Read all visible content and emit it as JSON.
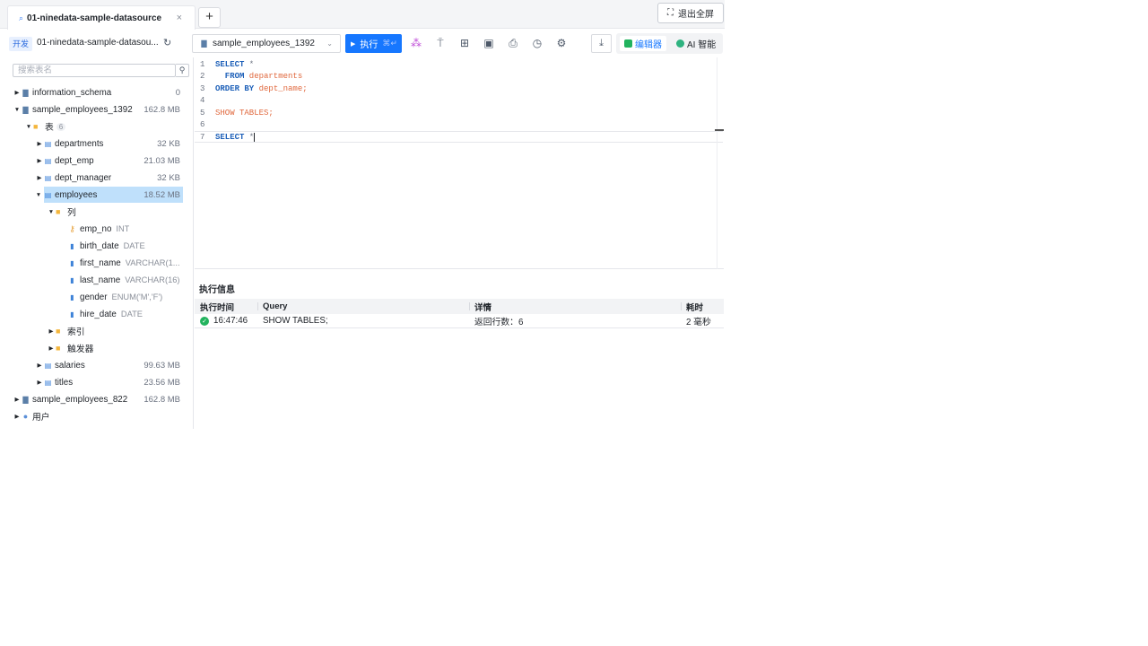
{
  "tabs": {
    "active_title": "01-ninedata-sample-datasource",
    "add_label": "+",
    "exit_fullscreen_label": "退出全屏"
  },
  "toolbar": {
    "env_label": "开发",
    "datasource": "01-ninedata-sample-datasou...",
    "database_selected": "sample_employees_1392",
    "run_label": "执行",
    "run_shortcut": "⌘↵",
    "editor_label": "编辑器",
    "ai_label": "AI 智能"
  },
  "sidebar": {
    "search_placeholder": "搜索表名",
    "tree": [
      {
        "label": "information_schema",
        "size": "0"
      },
      {
        "label": "sample_employees_1392",
        "size": "162.8 MB"
      },
      {
        "label": "表",
        "count": "6"
      },
      {
        "label": "departments",
        "size": "32 KB"
      },
      {
        "label": "dept_emp",
        "size": "21.03 MB"
      },
      {
        "label": "dept_manager",
        "size": "32 KB"
      },
      {
        "label": "employees",
        "size": "18.52 MB"
      },
      {
        "label": "列"
      },
      {
        "label": "emp_no",
        "type": "INT"
      },
      {
        "label": "birth_date",
        "type": "DATE"
      },
      {
        "label": "first_name",
        "type": "VARCHAR(1..."
      },
      {
        "label": "last_name",
        "type": "VARCHAR(16)"
      },
      {
        "label": "gender",
        "type": "ENUM('M','F')"
      },
      {
        "label": "hire_date",
        "type": "DATE"
      },
      {
        "label": "索引"
      },
      {
        "label": "触发器"
      },
      {
        "label": "salaries",
        "size": "99.63 MB"
      },
      {
        "label": "titles",
        "size": "23.56 MB"
      },
      {
        "label": "sample_employees_822",
        "size": "162.8 MB"
      },
      {
        "label": "用户"
      }
    ]
  },
  "editor": {
    "lines": [
      {
        "n": "1",
        "kw": "SELECT",
        "rest": " *"
      },
      {
        "n": "2",
        "kw": "  FROM",
        "rest": " departments"
      },
      {
        "n": "3",
        "kw": "ORDER BY",
        "rest": " dept_name;"
      },
      {
        "n": "4"
      },
      {
        "n": "5",
        "rest": "SHOW TABLES;"
      },
      {
        "n": "6"
      },
      {
        "n": "7",
        "kw": "SELECT",
        "rest": " *"
      }
    ]
  },
  "results": {
    "tab_label": "执行信息",
    "columns": [
      "执行时间",
      "Query",
      "详情",
      "耗时"
    ],
    "rows": [
      {
        "time": "16:47:46",
        "query": "SHOW TABLES;",
        "detail": "返回行数：6",
        "duration": "2 毫秒"
      }
    ]
  }
}
